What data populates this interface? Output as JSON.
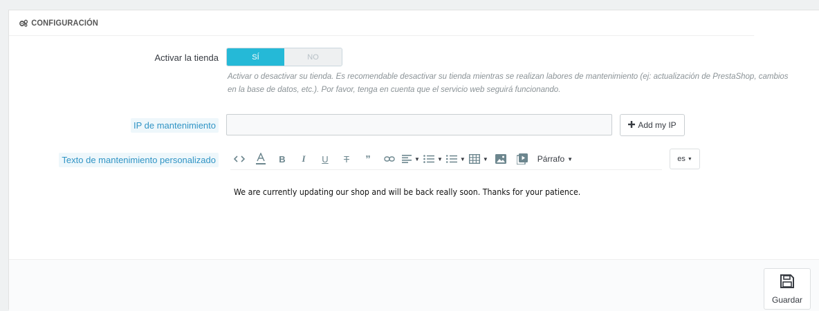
{
  "panel": {
    "heading": "CONFIGURACIÓN",
    "heading_icon": "gears-icon"
  },
  "shop_toggle": {
    "label": "Activar la tienda",
    "on_label": "SÍ",
    "off_label": "NO",
    "selected": "SÍ",
    "help": "Activar o desactivar su tienda. Es recomendable desactivar su tienda mientras se realizan labores de mantenimiento (ej: actualización de PrestaShop, cambios en la base de datos, etc.). Por favor, tenga en cuenta que el servicio web seguirá funcionando."
  },
  "maintenance_ip": {
    "label": "IP de mantenimiento",
    "value": "",
    "add_button": "Add my IP"
  },
  "maintenance_text": {
    "label": "Texto de mantenimiento personalizado",
    "format_label": "Párrafo",
    "language": "es",
    "content": "We are currently updating our shop and will be back really soon. Thanks for your patience."
  },
  "footer": {
    "save_label": "Guardar"
  },
  "colors": {
    "accent": "#25b9d7",
    "help_label": "#3094c5"
  }
}
